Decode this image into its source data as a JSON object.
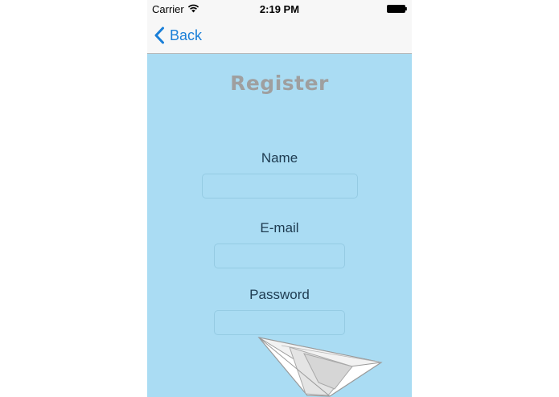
{
  "status_bar": {
    "carrier": "Carrier",
    "time": "2:19 PM",
    "icons": [
      "wifi-icon",
      "battery-icon"
    ]
  },
  "nav": {
    "back_label": "Back",
    "icon": "chevron-left-icon",
    "accent_color": "#1a7fd8"
  },
  "form": {
    "title": "Register",
    "background_color": "#aadcf3",
    "fields": [
      {
        "label": "Name",
        "value": "",
        "placeholder": ""
      },
      {
        "label": "E-mail",
        "value": "",
        "placeholder": ""
      },
      {
        "label": "Password",
        "value": "",
        "placeholder": ""
      }
    ],
    "submit_icon": "paper-plane-icon"
  }
}
